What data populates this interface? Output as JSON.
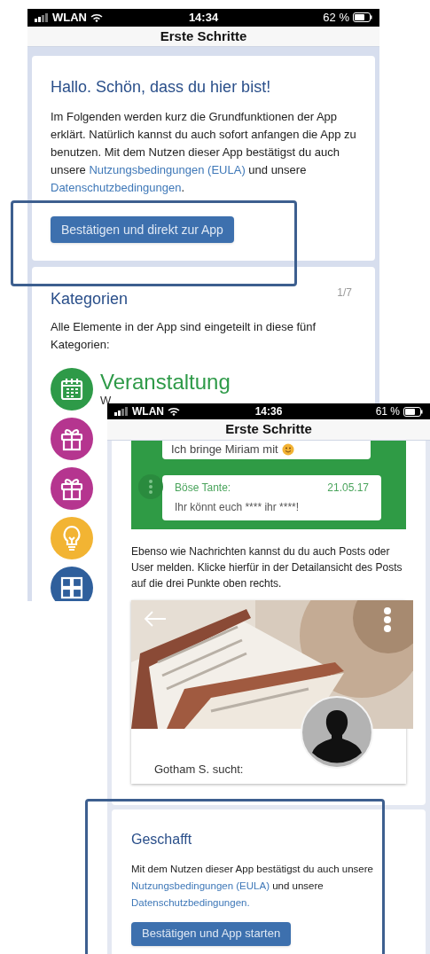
{
  "screen_1": {
    "status_bar": {
      "carrier": "WLAN",
      "time": "14:34",
      "battery": "62 %"
    },
    "header": {
      "title": "Erste Schritte"
    },
    "welcome_card": {
      "title": "Hallo. Schön, dass du hier bist!",
      "body": [
        {
          "kind": "text",
          "text": "Im Folgenden werden kurz die Grundfunktionen der App erklärt. Natürlich kannst du auch sofort anfangen die App zu benutzen. Mit dem Nutzen dieser App bestätigst du auch unsere "
        },
        {
          "kind": "link",
          "text": "Nutzungsbedingungen (EULA)"
        },
        {
          "kind": "text",
          "text": " und unsere "
        },
        {
          "kind": "link",
          "text": "Datenschutzbedingungen"
        },
        {
          "kind": "text",
          "text": "."
        }
      ],
      "button": "Bestätigen und direkt zur App",
      "highlighted": true
    },
    "categories_card": {
      "title": "Kategorien",
      "page": "1/7",
      "body": "Alle Elemente in der App sind eingeteilt in diese fünf Kategorien:",
      "categories": [
        {
          "kind": "calendar",
          "title": "Veranstaltung",
          "subtitle": "W",
          "color": "#2e9a48"
        },
        {
          "kind": "gift",
          "color": "#b5358f"
        },
        {
          "kind": "gift",
          "color": "#b5358f"
        },
        {
          "kind": "bulb",
          "color": "#f2b433"
        },
        {
          "kind": "grid",
          "color": "#2f5f9c"
        }
      ]
    }
  },
  "screen_2": {
    "status_bar": {
      "carrier": "WLAN",
      "time": "14:36",
      "battery": "61 %"
    },
    "header": {
      "title": "Erste Schritte"
    },
    "messages": [
      {
        "text": "Ich bringe Miriam mit"
      },
      {
        "author": "Böse Tante:",
        "date": "21.05.17",
        "text": "Ihr könnt euch **** ihr ****!"
      }
    ],
    "paragraph": "Ebenso wie Nachrichten kannst du du auch Posts oder User melden. Klicke hierfür in der Detailansicht des Posts auf die drei Punkte oben rechts.",
    "post": {
      "caption": "Gotham S. sucht:"
    },
    "final_card": {
      "title": "Geschafft",
      "body": [
        {
          "kind": "text",
          "text": "Mit dem Nutzen dieser App bestätigst du auch unsere "
        },
        {
          "kind": "link",
          "text": "Nutzungsbedingungen (EULA)"
        },
        {
          "kind": "text",
          "text": " und unsere "
        },
        {
          "kind": "link",
          "text": "Datenschutzbedingungen."
        }
      ],
      "button": "Bestätigen und App starten",
      "highlighted": true
    }
  }
}
